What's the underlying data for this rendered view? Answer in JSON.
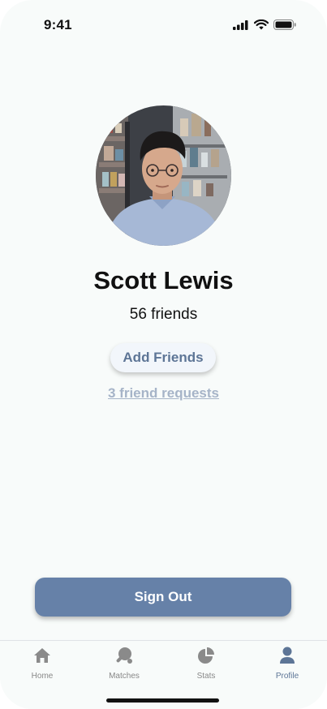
{
  "status_bar": {
    "time": "9:41"
  },
  "profile": {
    "name": "Scott Lewis",
    "friend_count": "56 friends",
    "add_friends_label": "Add Friends",
    "friend_requests_label": "3 friend requests"
  },
  "sign_out_label": "Sign Out",
  "tab_bar": {
    "active": "Profile",
    "tabs": [
      {
        "label": "Home",
        "icon": "home-icon"
      },
      {
        "label": "Matches",
        "icon": "ping-pong-icon"
      },
      {
        "label": "Stats",
        "icon": "pie-chart-icon"
      },
      {
        "label": "Profile",
        "icon": "person-icon"
      }
    ]
  },
  "colors": {
    "accent": "#6681a8",
    "link": "#a6b4c8",
    "active_tab": "#5d7596",
    "inactive_tab": "#888888"
  }
}
